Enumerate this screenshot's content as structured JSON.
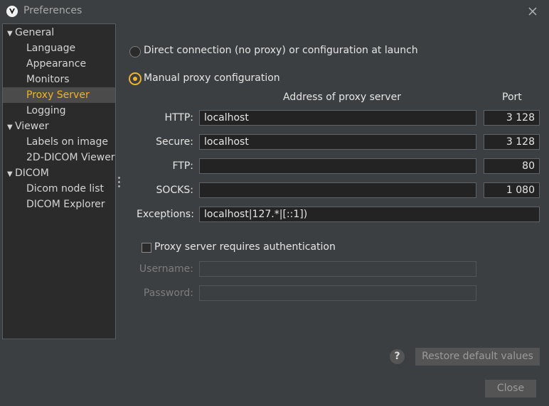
{
  "window": {
    "title": "Preferences",
    "app_icon": "viewer-logo-icon",
    "close_icon": "close-icon"
  },
  "tree": [
    {
      "label": "General",
      "type": "category"
    },
    {
      "label": "Language",
      "type": "child"
    },
    {
      "label": "Appearance",
      "type": "child"
    },
    {
      "label": "Monitors",
      "type": "child"
    },
    {
      "label": "Proxy Server",
      "type": "child",
      "selected": true
    },
    {
      "label": "Logging",
      "type": "child"
    },
    {
      "label": "Viewer",
      "type": "category"
    },
    {
      "label": "Labels on image",
      "type": "child"
    },
    {
      "label": "2D-DICOM Viewer",
      "type": "child"
    },
    {
      "label": "DICOM",
      "type": "category"
    },
    {
      "label": "Dicom node list",
      "type": "child"
    },
    {
      "label": "DICOM Explorer",
      "type": "child"
    }
  ],
  "proxy": {
    "direct_label": "Direct connection (no proxy) or configuration at launch",
    "manual_label": "Manual proxy configuration",
    "selected_mode": "manual",
    "address_header": "Address of proxy server",
    "port_header": "Port",
    "http_label": "HTTP:",
    "http_host": "localhost",
    "http_port": "3 128",
    "secure_label": "Secure:",
    "secure_host": "localhost",
    "secure_port": "3 128",
    "ftp_label": "FTP:",
    "ftp_host": "",
    "ftp_port": "80",
    "socks_label": "SOCKS:",
    "socks_host": "",
    "socks_port": "1 080",
    "exceptions_label": "Exceptions:",
    "exceptions_value": "localhost|127.*|[::1])",
    "auth_label": "Proxy server requires authentication",
    "auth_checked": false,
    "username_label": "Username:",
    "username_value": "",
    "password_label": "Password:",
    "password_value": ""
  },
  "buttons": {
    "help": "?",
    "restore": "Restore default values",
    "close": "Close"
  },
  "colors": {
    "accent": "#f0b429",
    "background": "#3c3f41",
    "panel": "#2b2b2b"
  }
}
